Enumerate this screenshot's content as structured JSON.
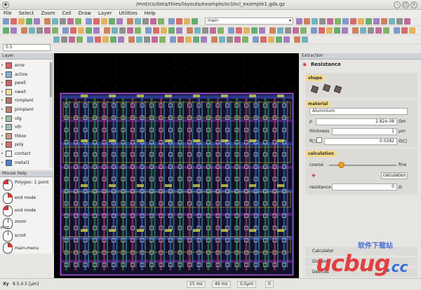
{
  "window": {
    "title": "/mnt/cs/data/thies/layouts/example/ocl/ocl_example1.gds.gz"
  },
  "menu": [
    "File",
    "Select",
    "Zoom",
    "Cell",
    "Draw",
    "Layer",
    "Utilities",
    "Help"
  ],
  "toolbar": {
    "cell_select": "main",
    "coord_field": "0.5"
  },
  "layer_panel": {
    "title": "Layer",
    "layers": [
      {
        "name": "error",
        "color": "#e06060"
      },
      {
        "name": "active",
        "color": "#8ab0d0"
      },
      {
        "name": "pwell",
        "color": "#c86464"
      },
      {
        "name": "nwell",
        "color": "#f0e0a0"
      },
      {
        "name": "nimplant",
        "color": "#b07868"
      },
      {
        "name": "pimplant",
        "color": "#c08070"
      },
      {
        "name": "vtg",
        "color": "#9cc0a0"
      },
      {
        "name": "vth",
        "color": "#a0c0b8"
      },
      {
        "name": "thkox",
        "color": "#c89880"
      },
      {
        "name": "poly",
        "color": "#d07070"
      },
      {
        "name": "contact",
        "color": "#f0f0f0"
      },
      {
        "name": "metal1",
        "color": "#5080c8"
      }
    ]
  },
  "mouse_help": {
    "title": "Mouse Help",
    "items": [
      {
        "text": "Polygon: 1 point"
      },
      {
        "text": "end mode"
      },
      {
        "text": "end mode"
      },
      {
        "text": "zoom"
      },
      {
        "text": "scroll"
      },
      {
        "text": "main-menu"
      }
    ],
    "side_label": "print"
  },
  "extraction": {
    "panel_title": "Extraction",
    "tool": "Resistance",
    "shape_label": "shape",
    "material_label": "material",
    "material": "Aluminium",
    "rho_label": "ρ",
    "rho_value": "2.82e-08",
    "rho_unit": "Ωm",
    "thickness_label": "thickness",
    "thickness_value": "1",
    "thickness_unit": "µm",
    "r_label": "R□",
    "r_value": "0.0282",
    "r_unit": "Ω/□",
    "calc_label": "calculation",
    "coarse_label": "coarse",
    "fine_label": "fine",
    "calc_button": "calculation",
    "resistance_label": "resistance",
    "resistance_value": "0",
    "resistance_unit": "Ω",
    "lower_tabs": [
      "Calculator",
      "Distance",
      "Devices"
    ]
  },
  "status": {
    "coords": "8.5,4.5 [µm]",
    "time1": "15 ms",
    "time2": "49 ms",
    "grid": "0,5µm",
    "count": "0"
  },
  "watermark": {
    "brand": "ucbug",
    "tld": ".cc",
    "cn": "软件下载站"
  },
  "colors": {
    "canvas": "#000000",
    "accent": "#f0a020",
    "panel_head": "#cfd2d6"
  }
}
